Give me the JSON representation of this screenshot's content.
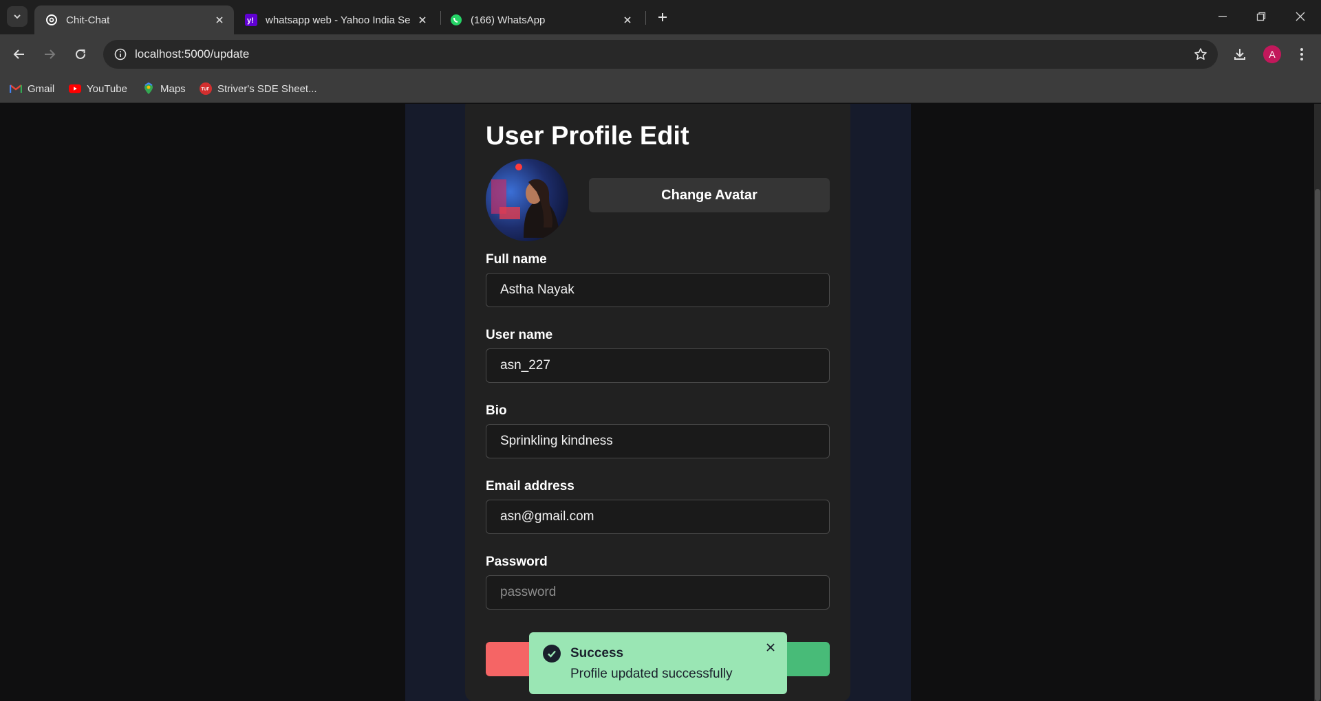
{
  "browser": {
    "tabs": [
      {
        "title": "Chit-Chat",
        "active": true,
        "favicon": "threads-icon"
      },
      {
        "title": "whatsapp web - Yahoo India Se",
        "active": false,
        "favicon": "yahoo-icon"
      },
      {
        "title": "(166) WhatsApp",
        "active": false,
        "favicon": "whatsapp-icon"
      }
    ],
    "url": "localhost:5000/update",
    "profile_initial": "A",
    "bookmarks": [
      {
        "label": "Gmail",
        "icon": "gmail-icon"
      },
      {
        "label": "YouTube",
        "icon": "youtube-icon"
      },
      {
        "label": "Maps",
        "icon": "maps-icon"
      },
      {
        "label": "Striver's SDE Sheet...",
        "icon": "tuf-icon"
      }
    ]
  },
  "page": {
    "heading": "User Profile Edit",
    "change_avatar_label": "Change Avatar",
    "fields": {
      "full_name": {
        "label": "Full name",
        "value": "Astha Nayak",
        "placeholder": ""
      },
      "user_name": {
        "label": "User name",
        "value": "asn_227",
        "placeholder": ""
      },
      "bio": {
        "label": "Bio",
        "value": "Sprinkling kindness",
        "placeholder": ""
      },
      "email": {
        "label": "Email address",
        "value": "asn@gmail.com",
        "placeholder": ""
      },
      "password": {
        "label": "Password",
        "value": "",
        "placeholder": "password"
      }
    }
  },
  "toast": {
    "title": "Success",
    "description": "Profile updated successfully"
  },
  "colors": {
    "cancel": "#f56565",
    "update": "#48bb78",
    "toast_bg": "#9ae6b4",
    "profile_avatar": "#c2185b"
  }
}
